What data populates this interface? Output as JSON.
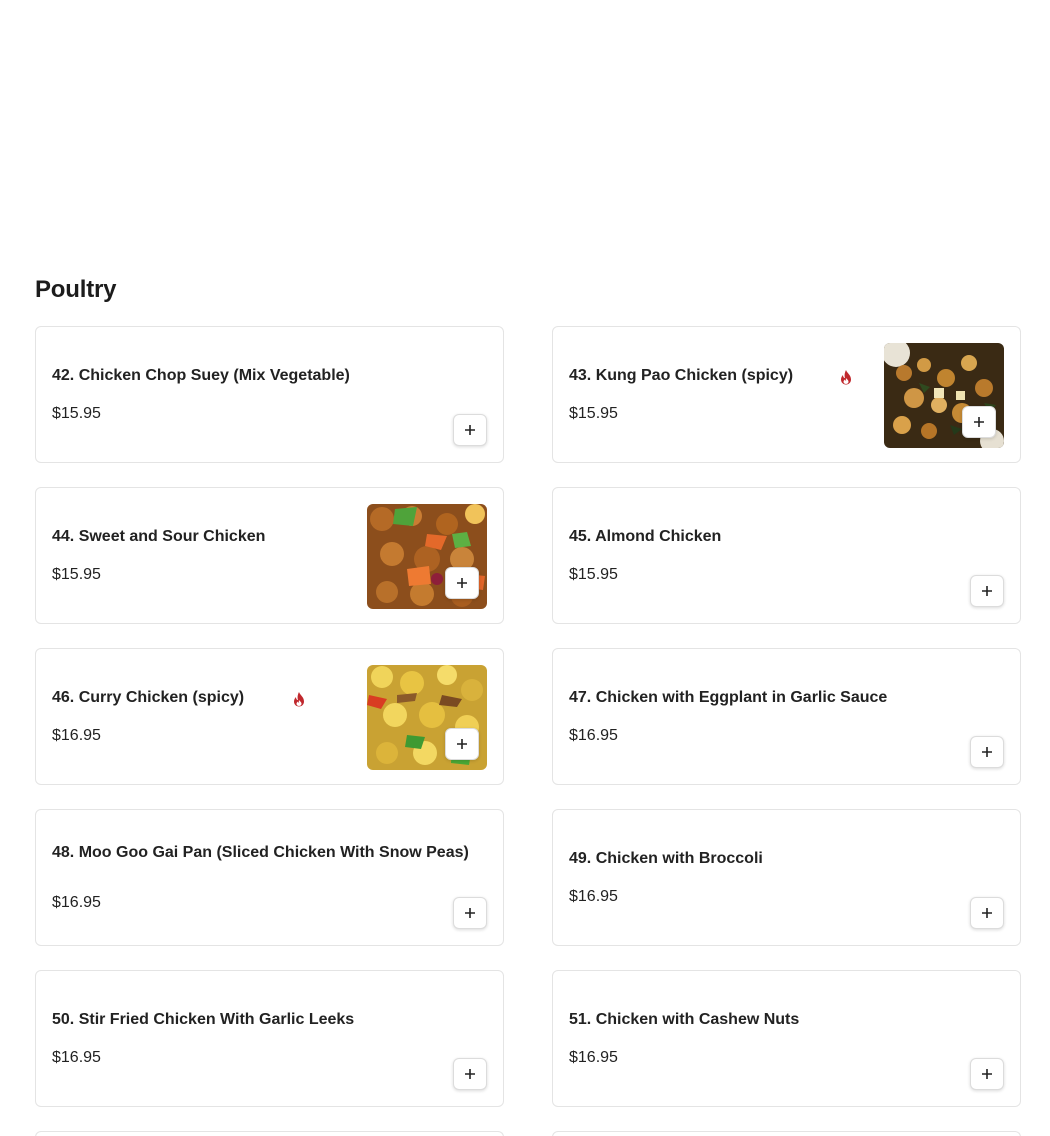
{
  "section": {
    "title": "Poultry"
  },
  "colors": {
    "spicy": "#c0282d",
    "border": "#e4e4e4",
    "text": "#222222"
  },
  "items": [
    {
      "name": "42. Chicken Chop Suey (Mix Vegetable)",
      "price": "$15.95",
      "spicy": false,
      "image": null
    },
    {
      "name": "43. Kung Pao Chicken (spicy)",
      "price": "$15.95",
      "spicy": true,
      "image": "kung-pao-chicken-photo"
    },
    {
      "name": "44. Sweet and Sour Chicken",
      "price": "$15.95",
      "spicy": false,
      "image": "sweet-and-sour-chicken-photo"
    },
    {
      "name": "45. Almond Chicken",
      "price": "$15.95",
      "spicy": false,
      "image": null
    },
    {
      "name": "46. Curry Chicken (spicy)",
      "price": "$16.95",
      "spicy": true,
      "image": "curry-chicken-photo"
    },
    {
      "name": "47. Chicken with Eggplant in Garlic Sauce",
      "price": "$16.95",
      "spicy": false,
      "image": null
    },
    {
      "name": "48. Moo Goo Gai Pan (Sliced Chicken With Snow Peas)",
      "price": "$16.95",
      "spicy": false,
      "image": null
    },
    {
      "name": "49. Chicken with Broccoli",
      "price": "$16.95",
      "spicy": false,
      "image": null
    },
    {
      "name": "50. Stir Fried Chicken With Garlic Leeks",
      "price": "$16.95",
      "spicy": false,
      "image": null
    },
    {
      "name": "51. Chicken with Cashew Nuts",
      "price": "$16.95",
      "spicy": false,
      "image": null
    }
  ],
  "icons": {
    "add": "plus-icon",
    "spicy": "flame-icon"
  }
}
